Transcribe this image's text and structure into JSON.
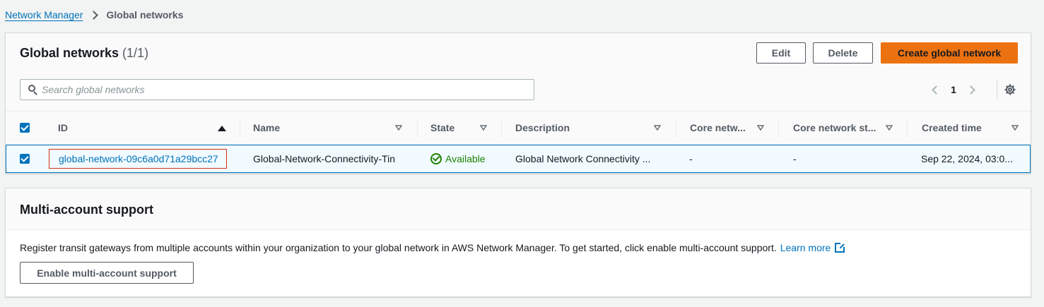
{
  "breadcrumb": {
    "parent": "Network Manager",
    "current": "Global networks"
  },
  "global_networks": {
    "title": "Global networks",
    "count": "(1/1)",
    "buttons": {
      "edit": "Edit",
      "delete": "Delete",
      "create": "Create global network"
    },
    "search_placeholder": "Search global networks",
    "page": "1",
    "columns": [
      "ID",
      "Name",
      "State",
      "Description",
      "Core netw...",
      "Core network st...",
      "Created time"
    ],
    "rows": [
      {
        "selected": true,
        "id": "global-network-09c6a0d71a29bcc27",
        "name": "Global-Network-Connectivity-Tin",
        "state": "Available",
        "description": "Global Network Connectivity ...",
        "core_network": "-",
        "core_network_state": "-",
        "created_time": "Sep 22, 2024, 03:0..."
      }
    ]
  },
  "multi_account": {
    "title": "Multi-account support",
    "description": "Register transit gateways from multiple accounts within your organization to your global network in AWS Network Manager. To get started, click enable multi-account support.",
    "learn_more": "Learn more",
    "button": "Enable multi-account support"
  },
  "colors": {
    "accent": "#0073bb",
    "primary_button": "#ec7211",
    "success": "#1d8102",
    "highlight_border": "#d13212"
  },
  "icons": [
    "chevron-right-icon",
    "search-icon",
    "chevron-left-icon",
    "settings-gear-icon",
    "sort-ascending-icon",
    "sort-icon",
    "checkbox-icon",
    "status-available-icon",
    "external-link-icon"
  ]
}
